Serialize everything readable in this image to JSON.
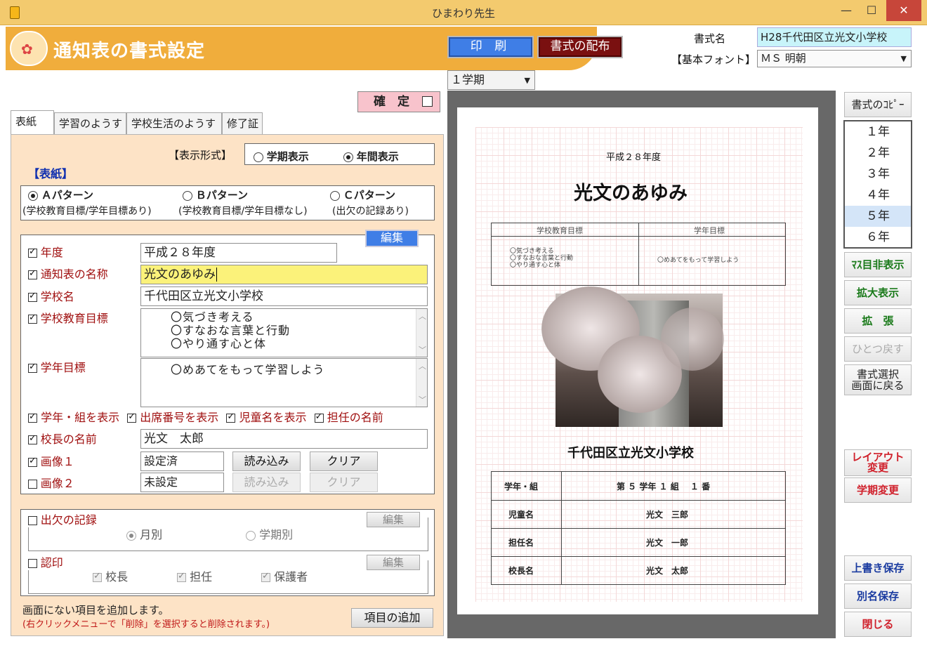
{
  "window": {
    "title": "ひまわり先生",
    "min": "—",
    "max": "☐",
    "close": "✕"
  },
  "header": {
    "title": "通知表の書式設定",
    "print_label": "印 刷",
    "distribute_label": "書式の配布",
    "format_name_label": "書式名",
    "format_name_value": "H28千代田区立光文小学校",
    "font_label": "【基本フォント】",
    "font_value": "ＭＳ 明朝",
    "term_select": "１学期"
  },
  "confirm": {
    "label": "確　定"
  },
  "tabs": [
    "表紙",
    "学習のようす",
    "学校生活のようす",
    "修了証"
  ],
  "display": {
    "label": "【表示形式】",
    "option1": "学期表示",
    "option2": "年間表示",
    "selected": "年間表示"
  },
  "cover": {
    "section_title": "【表紙】",
    "patterns": [
      {
        "label": "Ａパターン",
        "desc": "(学校教育目標/学年目標あり)",
        "selected": true
      },
      {
        "label": "Ｂパターン",
        "desc": "(学校教育目標/学年目標なし)",
        "selected": false
      },
      {
        "label": "Ｃパターン",
        "desc": "(出欠の記録あり)",
        "selected": false
      }
    ],
    "edit_label": "編集"
  },
  "fields": {
    "year": {
      "label": "年度",
      "value": "平成２８年度"
    },
    "report_name": {
      "label": "通知表の名称",
      "value": "光文のあゆみ"
    },
    "school_name": {
      "label": "学校名",
      "value": "千代田区立光文小学校"
    },
    "school_goal": {
      "label": "学校教育目標",
      "lines": [
        "〇気づき考える",
        "〇すなおな言葉と行動",
        "〇やり通す心と体"
      ]
    },
    "grade_goal": {
      "label": "学年目標",
      "lines": [
        "〇めあてをもって学習しよう"
      ]
    },
    "show_grade": "学年・組を表示",
    "show_number": "出席番号を表示",
    "show_child": "児童名を表示",
    "show_teacher": "担任の名前",
    "principal": {
      "label": "校長の名前",
      "value": "光文　太郎"
    },
    "image1": {
      "label": "画像１",
      "value": "設定済",
      "load": "読み込み",
      "clear": "クリア"
    },
    "image2": {
      "label": "画像２",
      "value": "未設定",
      "load": "読み込み",
      "clear": "クリア"
    }
  },
  "attendance": {
    "label": "出欠の記録",
    "edit_label": "編集",
    "opt1": "月別",
    "opt2": "学期別"
  },
  "seal": {
    "label": "認印",
    "edit_label": "編集",
    "items": [
      "校長",
      "担任",
      "保護者"
    ]
  },
  "footer": {
    "hint": "画面にない項目を追加します。",
    "hint2": "(右クリックメニューで「削除」を選択すると削除されます。)",
    "add_label": "項目の追加"
  },
  "preview": {
    "year": "平成２８年度",
    "title": "光文のあゆみ",
    "goal_headers": [
      "学校教育目標",
      "学年目標"
    ],
    "school_goal_lines": [
      "〇気づき考える",
      "〇すなおな言葉と行動",
      "〇やり通す心と体"
    ],
    "grade_goal": "〇めあてをもって学習しよう",
    "school": "千代田区立光文小学校",
    "rows": [
      {
        "k": "学年・組",
        "v": "第 ５ 学年 １ 組 　１ 番"
      },
      {
        "k": "児童名",
        "v": "光文　三郎"
      },
      {
        "k": "担任名",
        "v": "光文　一郎"
      },
      {
        "k": "校長名",
        "v": "光文　太郎"
      }
    ]
  },
  "side": {
    "copy_label": "書式のｺﾋﾟｰ",
    "years": [
      "１年",
      "２年",
      "３年",
      "４年",
      "５年",
      "６年"
    ],
    "selected_year": "５年",
    "grid_hide": "ﾏｽ目非表示",
    "zoom": "拡大表示",
    "expand": "拡　張",
    "undo": "ひとつ戻す",
    "back_l1": "書式選択",
    "back_l2": "画面に戻る",
    "layout_l1": "レイアウト",
    "layout_l2": "変更",
    "term_change": "学期変更",
    "save": "上書き保存",
    "save_as": "別名保存",
    "close": "閉じる"
  }
}
